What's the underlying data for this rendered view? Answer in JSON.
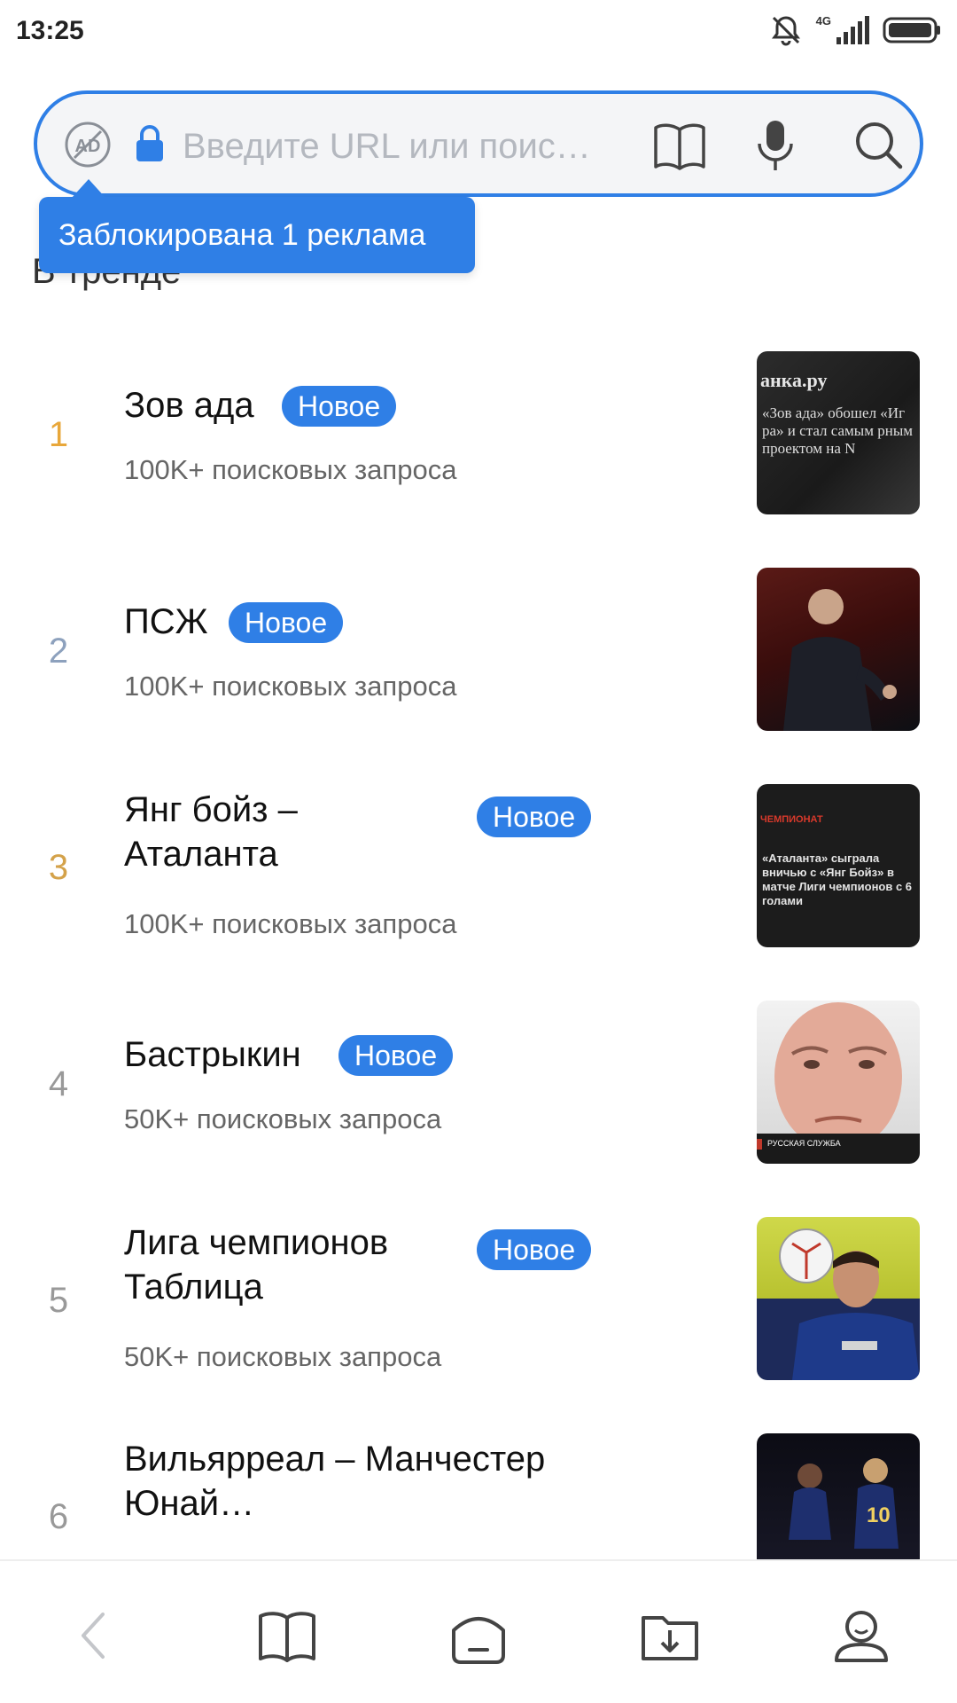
{
  "status_bar": {
    "time": "13:25",
    "network": "4G"
  },
  "address_bar": {
    "placeholder": "Введите URL или поис…",
    "ad_icon_text": "AD"
  },
  "tooltip": {
    "text": "Заблокирована 1 реклама"
  },
  "section_title": "В тренде",
  "trending": [
    {
      "rank": "1",
      "title": "Зов ада",
      "badge": "Новое",
      "meta": "100K+ поисковых запроса",
      "thumb": {
        "source": "анка.ру",
        "caption": "«Зов ада» обошел «Иг ра» и стал самым рным проектом на N"
      }
    },
    {
      "rank": "2",
      "title": "ПСЖ",
      "badge": "Новое",
      "meta": "100K+ поисковых запроса"
    },
    {
      "rank": "3",
      "title": "Янг бойз – Аталанта",
      "badge": "Новое",
      "meta": "100K+ поисковых запроса",
      "thumb": {
        "source": "ЧЕМПИОНАТ",
        "caption": "«Аталанта» сыграла вничью с «Янг Бойз» в матче Лиги чемпионов с 6 голами"
      }
    },
    {
      "rank": "4",
      "title": "Бастрыкин",
      "badge": "Новое",
      "meta": "50K+ поисковых запроса",
      "thumb": {
        "source": "РУССКАЯ СЛУЖБА"
      }
    },
    {
      "rank": "5",
      "title": "Лига чемпионов Таблица",
      "badge": "Новое",
      "meta": "50K+ поисковых запроса"
    },
    {
      "rank": "6",
      "title": "Вильярреал – Манчестер Юнай…",
      "badge": "",
      "meta": ""
    }
  ],
  "colors": {
    "accent": "#2f7fe6",
    "rank1": "#e8a73a",
    "rank2": "#8da1bd",
    "rank3": "#d4a24a"
  },
  "bottom_nav": [
    "back-icon",
    "bookmarks-icon",
    "home-icon",
    "downloads-icon",
    "profile-icon"
  ]
}
